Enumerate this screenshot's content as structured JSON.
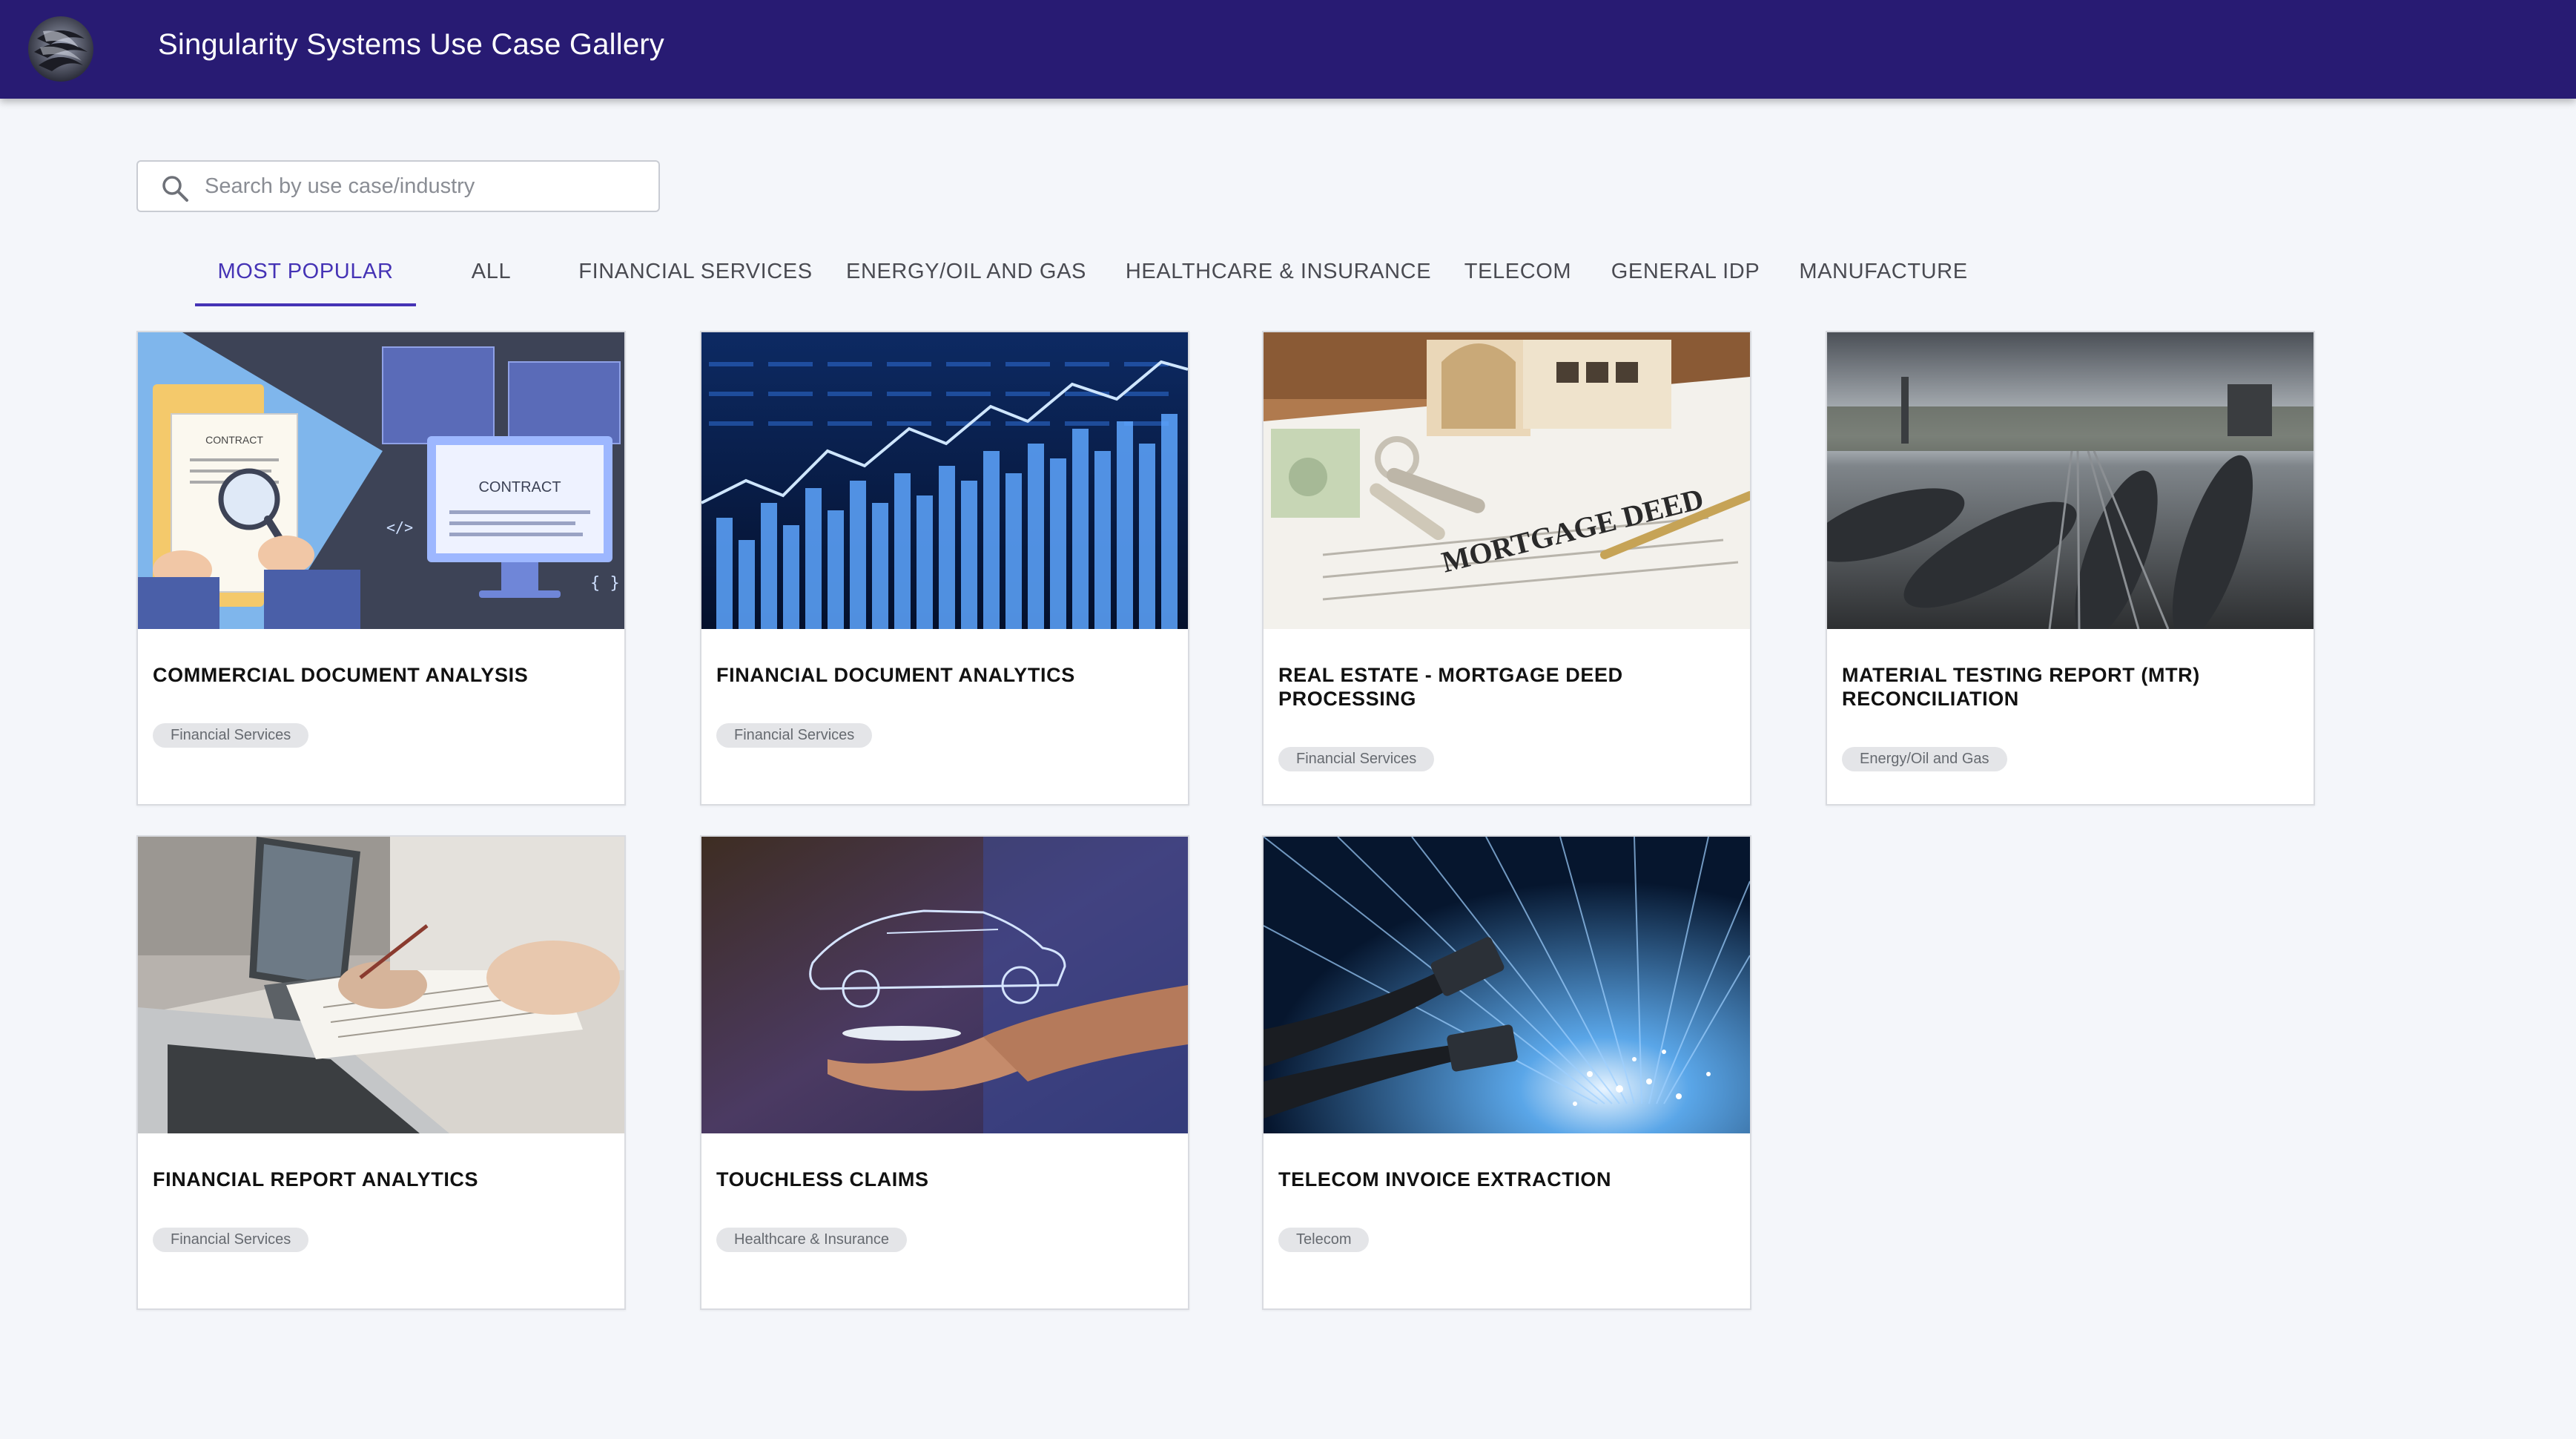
{
  "header": {
    "app_title": "Singularity Systems Use Case Gallery",
    "logo_icon": "logo-icon"
  },
  "search": {
    "placeholder": "Search by use case/industry",
    "value": "",
    "icon": "search-icon"
  },
  "tabs": [
    {
      "label": "MOST POPULAR",
      "active": true
    },
    {
      "label": "ALL"
    },
    {
      "label": "FINANCIAL SERVICES"
    },
    {
      "label": "ENERGY/OIL AND GAS"
    },
    {
      "label": "HEALTHCARE & INSURANCE"
    },
    {
      "label": "TELECOM"
    },
    {
      "label": "GENERAL IDP"
    },
    {
      "label": "MANUFACTURE"
    }
  ],
  "cards": [
    {
      "title": "COMMERCIAL DOCUMENT ANALYSIS",
      "tag": "Financial Services",
      "image": "contract-illustration",
      "image_texts": [
        "CONTRACT",
        "CONTRACT"
      ]
    },
    {
      "title": "FINANCIAL DOCUMENT ANALYTICS",
      "tag": "Financial Services",
      "image": "stock-chart-photo"
    },
    {
      "title": "REAL ESTATE - MORTGAGE DEED PROCESSING",
      "tag": "Financial Services",
      "image": "mortgage-deed-photo",
      "image_texts": [
        "MORTGAGE DEED"
      ]
    },
    {
      "title": "MATERIAL TESTING REPORT (MTR) RECONCILIATION",
      "tag": "Energy/Oil and Gas",
      "image": "rail-tank-cars-photo"
    },
    {
      "title": "FINANCIAL REPORT ANALYTICS",
      "tag": "Financial Services",
      "image": "laptop-meeting-photo"
    },
    {
      "title": "TOUCHLESS CLAIMS",
      "tag": "Healthcare & Insurance",
      "image": "car-hologram-photo"
    },
    {
      "title": "TELECOM INVOICE EXTRACTION",
      "tag": "Telecom",
      "image": "fiber-optic-photo"
    }
  ],
  "colors": {
    "appbar": "#281b73",
    "accent": "#4533b5",
    "background": "#f4f6fa"
  }
}
